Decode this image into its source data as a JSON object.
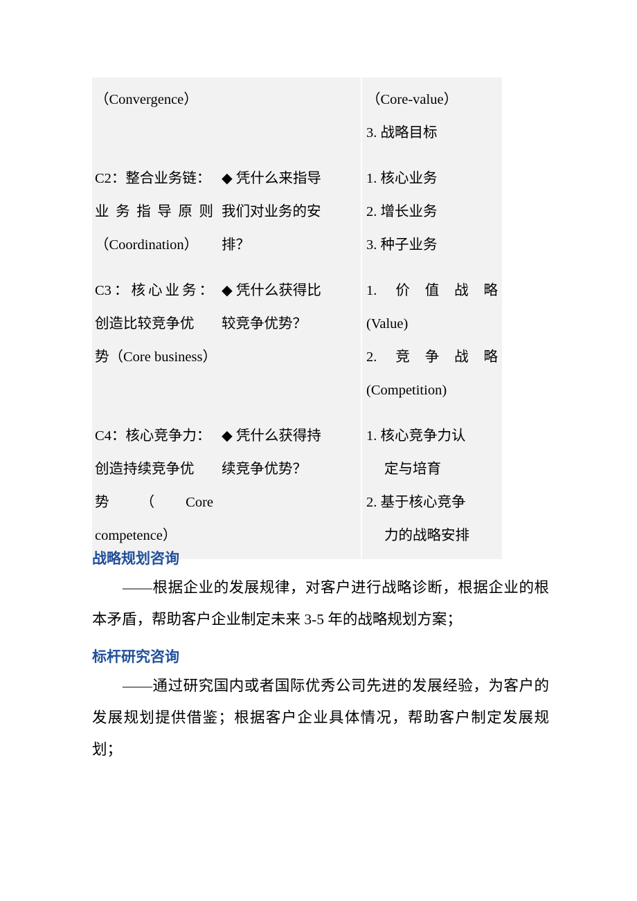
{
  "document": {
    "type": "chinese-business-document",
    "background_color": "#ffffff",
    "table_background_color": "#f2f2f2",
    "heading_color": "#21509b"
  },
  "table": {
    "rows": [
      {
        "id": "row-convergence",
        "col_a": [
          "（Convergence）"
        ],
        "col_b": [],
        "col_c": [
          "（Core-value）",
          "3. 战略目标"
        ]
      },
      {
        "id": "row-c2",
        "col_a": [
          "C2：整合业务链：",
          "业 务 指 导 原 则",
          "（Coordination）"
        ],
        "col_b": [
          "◆ 凭什么来指导",
          "我们对业务的安",
          "排？"
        ],
        "col_c": [
          "1. 核心业务",
          "2. 增长业务",
          "3. 种子业务"
        ]
      },
      {
        "id": "row-c3",
        "col_a": [
          "C3：核心业务：",
          "创造比较竞争优",
          "势（Core business）"
        ],
        "col_b": [
          "◆ 凭什么获得比",
          "较竞争优势？"
        ],
        "col_c": [
          "1. 价值战略",
          "(Value)",
          "2. 竞争战略",
          "(Competition)"
        ]
      },
      {
        "id": "row-c4",
        "col_a": [
          "C4：核心竞争力：",
          "创造持续竞争优",
          "势 （ Core",
          "competence）"
        ],
        "col_b": [
          "◆ 凭什么获得持",
          "续竞争优势？"
        ],
        "col_c": [
          "1. 核心竞争力认",
          "定与培育",
          "2. 基于核心竞争",
          "力的战略安排"
        ]
      }
    ]
  },
  "sections": [
    {
      "id": "section-strategic-planning",
      "heading": "战略规划咨询",
      "body": "——根据企业的发展规律，对客户进行战略诊断，根据企业的根本矛盾，帮助客户企业制定未来 3-5 年的战略规划方案；"
    },
    {
      "id": "section-benchmark-research",
      "heading": "标杆研究咨询",
      "body": "——通过研究国内或者国际优秀公司先进的发展经验，为客户的发展规划提供借鉴；根据客户企业具体情况，帮助客户制定发展规划；"
    }
  ]
}
